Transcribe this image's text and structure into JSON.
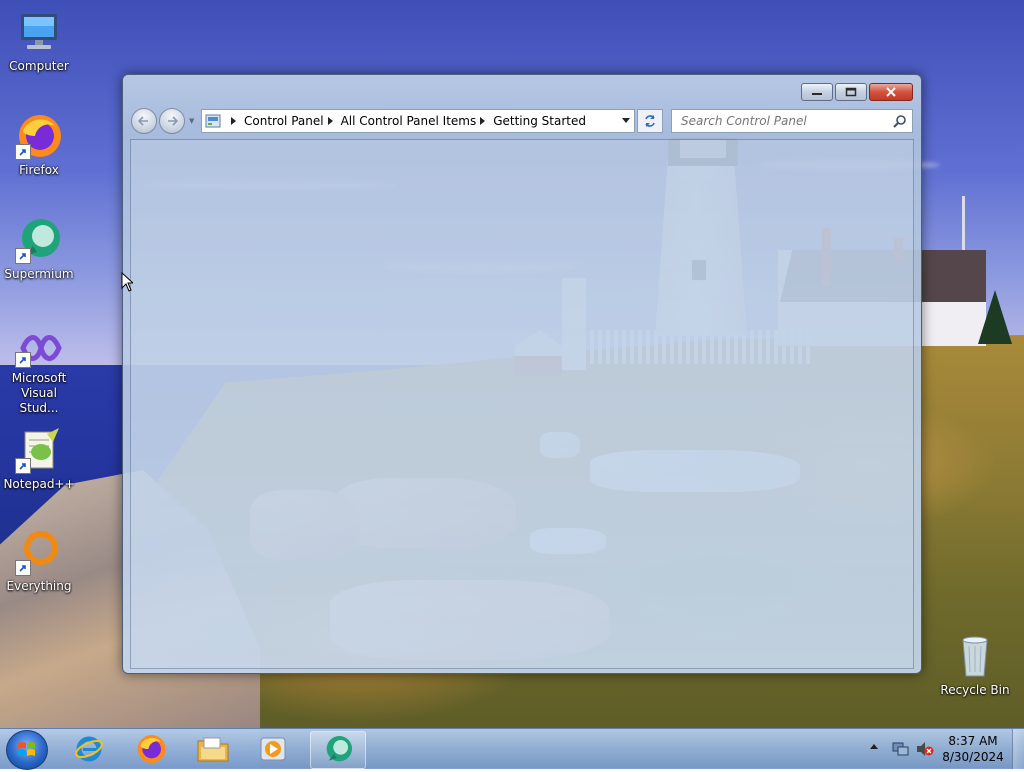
{
  "desktop": {
    "icons": [
      {
        "label": "Computer",
        "icon": "computer-icon"
      },
      {
        "label": "Firefox",
        "icon": "firefox-icon"
      },
      {
        "label": "Supermium",
        "icon": "supermium-icon"
      },
      {
        "label": "Microsoft Visual Stud...",
        "icon": "visual-studio-icon"
      },
      {
        "label": "Notepad++",
        "icon": "notepadpp-icon"
      },
      {
        "label": "Everything",
        "icon": "everything-icon"
      },
      {
        "label": "Recycle Bin",
        "icon": "recycle-bin-icon"
      }
    ]
  },
  "window": {
    "breadcrumb": [
      "Control Panel",
      "All Control Panel Items",
      "Getting Started"
    ],
    "search_placeholder": "Search Control Panel"
  },
  "taskbar": {
    "pinned": [
      "internet-explorer-icon",
      "firefox-icon",
      "file-explorer-icon",
      "media-player-icon",
      "supermium-icon"
    ],
    "clock_time": "8:37 AM",
    "clock_date": "8/30/2024"
  },
  "colors": {
    "accent": "#2a67c7",
    "close_button": "#c23a27"
  }
}
